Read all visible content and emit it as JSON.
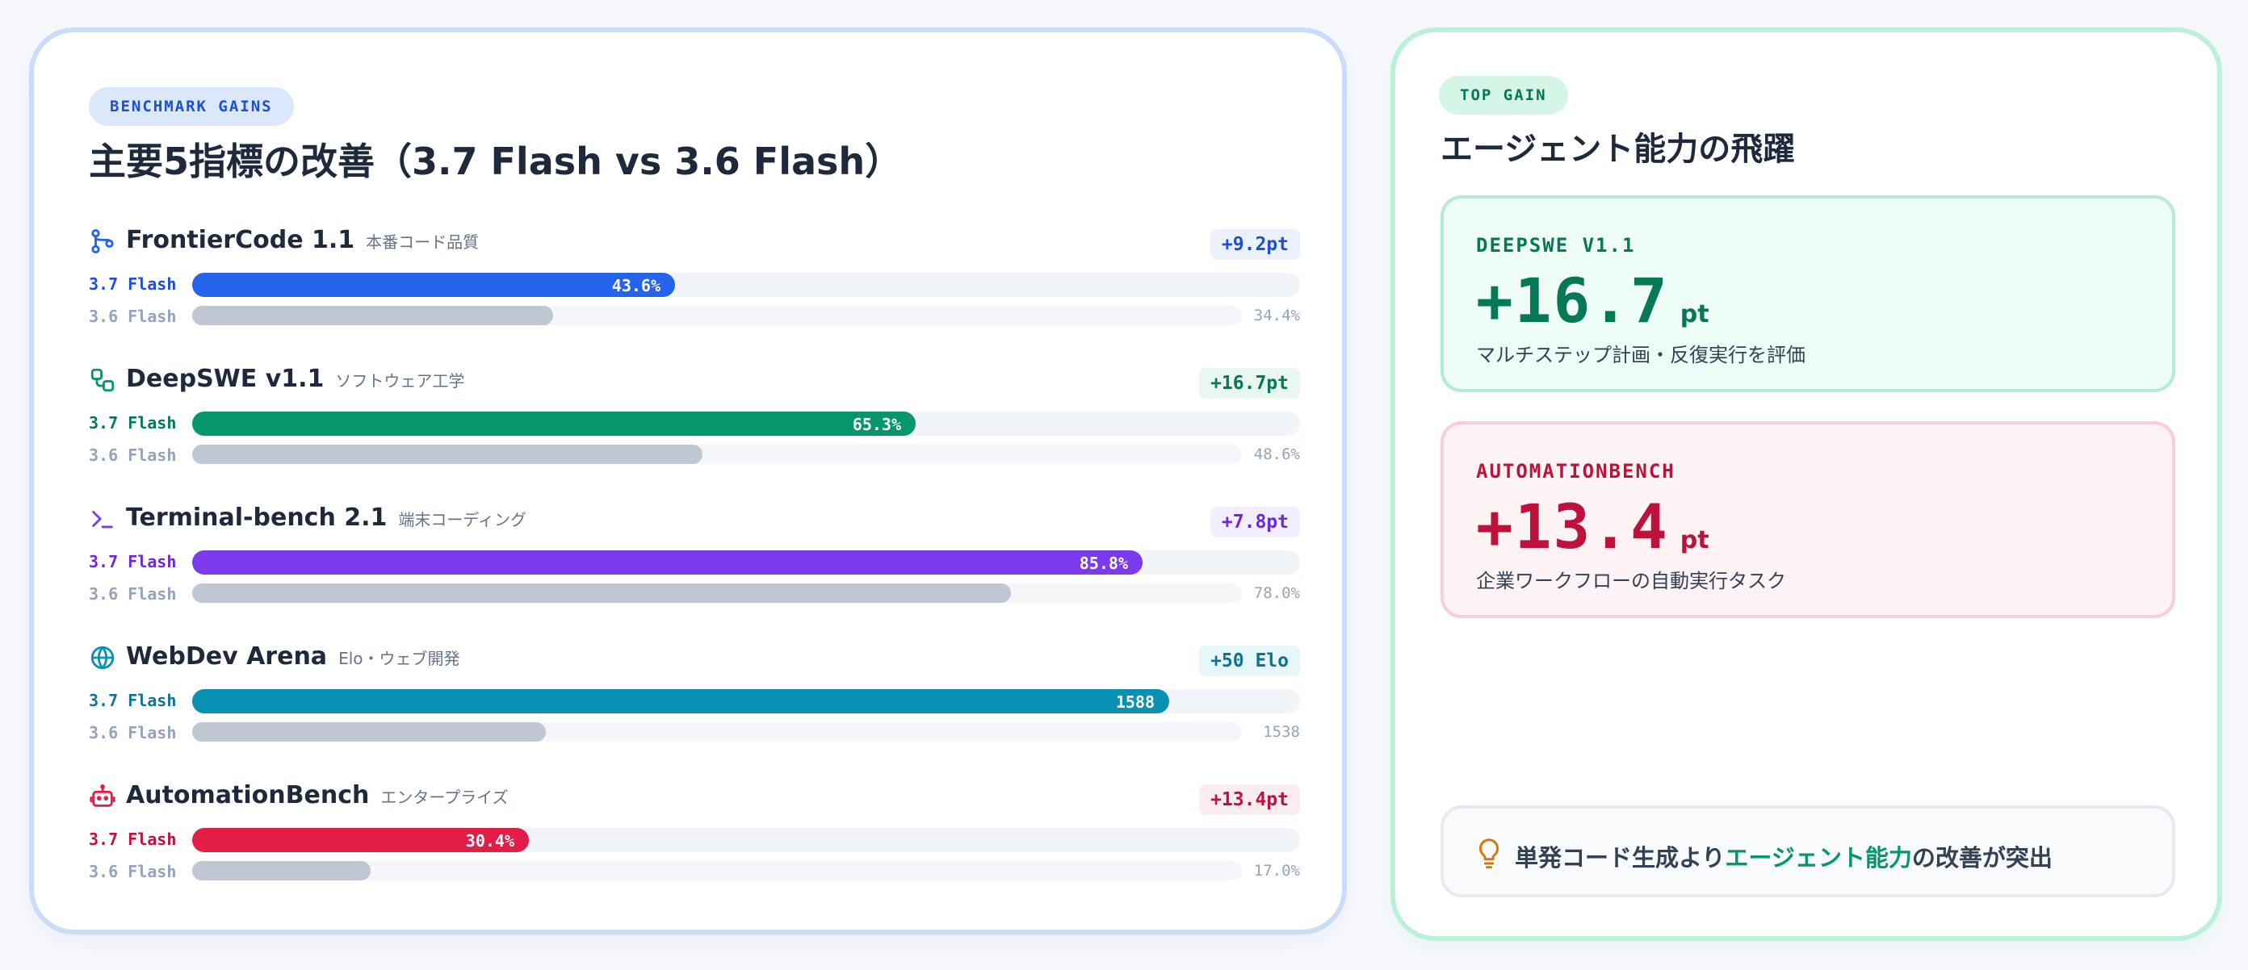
{
  "left_panel": {
    "badge": "BENCHMARK GAINS",
    "title": "主要5指標の改善（3.7 Flash vs 3.6 Flash）"
  },
  "right_panel": {
    "badge": "TOP GAIN",
    "title": "エージェント能力の飛躍",
    "highlights": [
      {
        "label": "DEEPSWE V1.1",
        "value": "+16.7",
        "unit": "pt",
        "desc": "マルチステップ計画・反復実行を評価",
        "color": "#047857"
      },
      {
        "label": "AUTOMATIONBENCH",
        "value": "+13.4",
        "unit": "pt",
        "desc": "企業ワークフローの自動実行タスク",
        "color": "#be123c"
      }
    ],
    "insight": {
      "pre": "単発コード生成より",
      "highlight": "エージェント能力",
      "post": "の改善が突出"
    }
  },
  "chart_data": {
    "type": "bar",
    "orientation": "horizontal",
    "series_labels": {
      "new": "3.7 Flash",
      "old": "3.6 Flash"
    },
    "metrics": [
      {
        "name": "FrontierCode 1.1",
        "subtitle": "本番コード品質",
        "gain": "+9.2pt",
        "new_value": 43.6,
        "old_value": 34.4,
        "new_label": "43.6%",
        "old_label": "34.4%",
        "max": 100,
        "color": "#2563eb",
        "text_color": "#1d4ed8",
        "gain_bg": "#eaf1fd",
        "icon": "git-branch-icon"
      },
      {
        "name": "DeepSWE v1.1",
        "subtitle": "ソフトウェア工学",
        "gain": "+16.7pt",
        "new_value": 65.3,
        "old_value": 48.6,
        "new_label": "65.3%",
        "old_label": "48.6%",
        "max": 100,
        "color": "#059669",
        "text_color": "#047857",
        "gain_bg": "#e8f8ef",
        "icon": "workflow-icon"
      },
      {
        "name": "Terminal-bench 2.1",
        "subtitle": "端末コーディング",
        "gain": "+7.8pt",
        "new_value": 85.8,
        "old_value": 78.0,
        "new_label": "85.8%",
        "old_label": "78.0%",
        "max": 100,
        "color": "#7c3aed",
        "text_color": "#6d28d9",
        "gain_bg": "#f3eefd",
        "icon": "terminal-icon"
      },
      {
        "name": "WebDev Arena",
        "subtitle": "Elo・ウェブ開発",
        "gain": "+50 Elo",
        "new_value": 1588,
        "old_value": 1538,
        "new_label": "1588",
        "old_label": "1538",
        "axis_min": 0,
        "axis_max_new": 1800,
        "color": "#0891b2",
        "text_color": "#0e7490",
        "gain_bg": "#e6f7fa",
        "icon": "globe-icon"
      },
      {
        "name": "AutomationBench",
        "subtitle": "エンタープライズ",
        "gain": "+13.4pt",
        "new_value": 30.4,
        "old_value": 17.0,
        "new_label": "30.4%",
        "old_label": "17.0%",
        "max": 100,
        "color": "#e11d48",
        "text_color": "#be123c",
        "gain_bg": "#fdecef",
        "icon": "robot-icon"
      }
    ]
  }
}
